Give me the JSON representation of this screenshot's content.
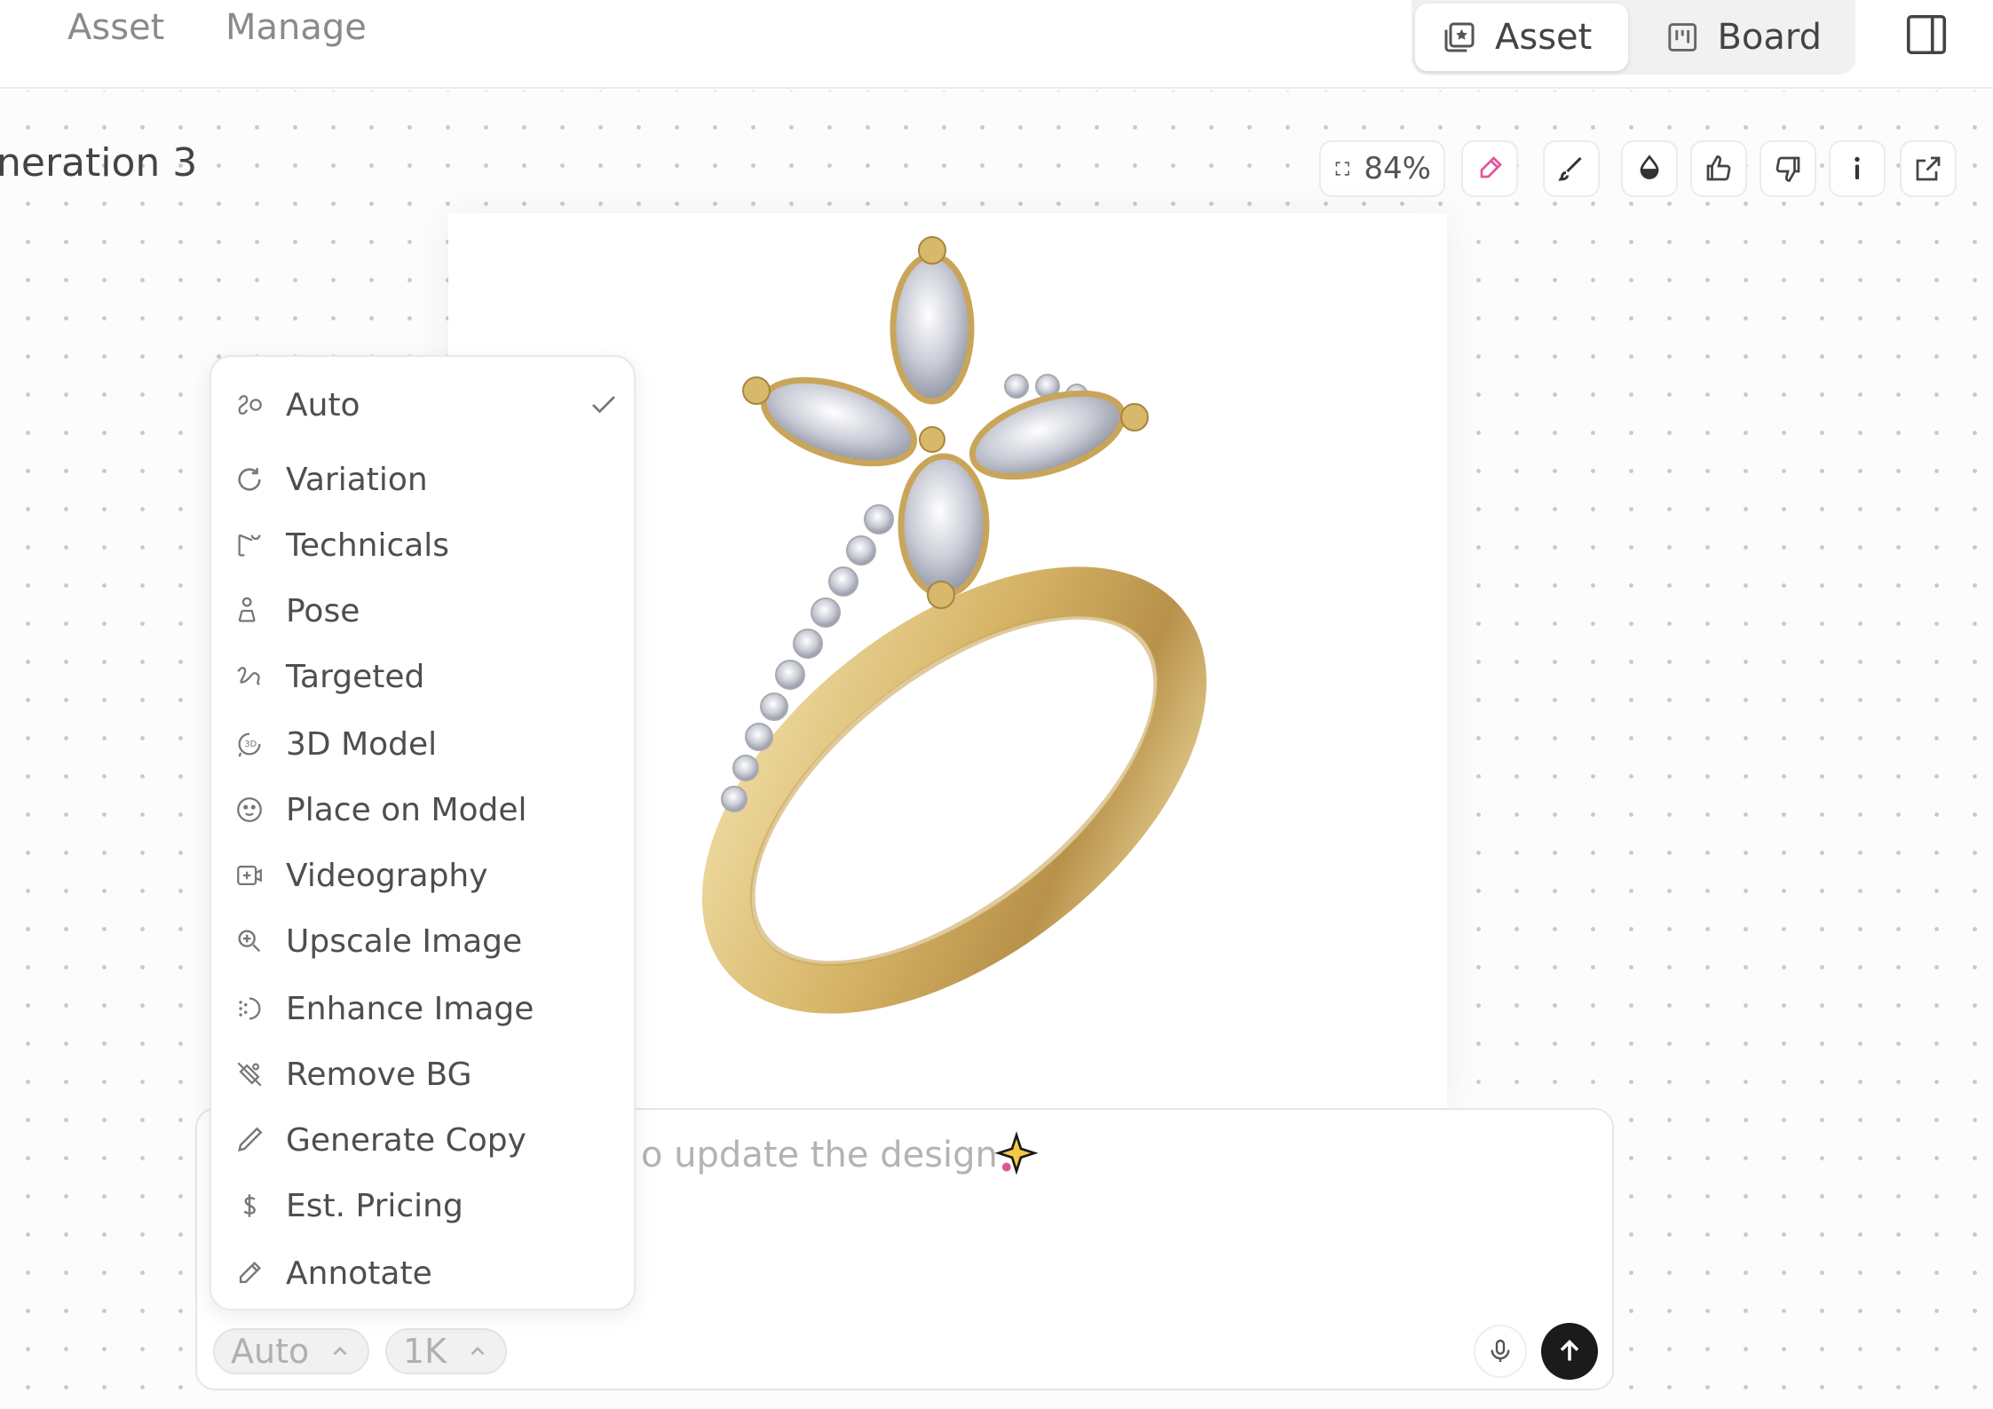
{
  "topbar": {
    "nav": [
      "Asset",
      "Manage"
    ],
    "view_toggle": [
      {
        "label": "Asset",
        "icon": "asset-icon",
        "active": true
      },
      {
        "label": "Board",
        "icon": "board-icon",
        "active": false
      }
    ],
    "panel_icon": "panel-toggle-icon"
  },
  "canvas": {
    "title": "neration 3",
    "zoom": "84%",
    "tools": [
      "fit-screen-icon",
      "color-picker-icon",
      "brush-icon",
      "tone-icon",
      "thumbs-up-icon",
      "thumbs-down-icon",
      "info-icon",
      "open-external-icon"
    ]
  },
  "menu": {
    "selected": "Auto",
    "items": [
      {
        "label": "Auto",
        "icon": "auto-icon"
      },
      {
        "label": "Variation",
        "icon": "refresh-icon"
      },
      {
        "label": "Technicals",
        "icon": "technicals-icon"
      },
      {
        "label": "Pose",
        "icon": "pose-icon"
      },
      {
        "label": "Targeted",
        "icon": "targeted-icon"
      },
      {
        "label": "3D Model",
        "icon": "rotate-3d-icon"
      },
      {
        "label": "Place on Model",
        "icon": "face-icon"
      },
      {
        "label": "Videography",
        "icon": "video-icon"
      },
      {
        "label": "Upscale Image",
        "icon": "zoom-in-icon"
      },
      {
        "label": "Enhance Image",
        "icon": "enhance-icon"
      },
      {
        "label": "Remove BG",
        "icon": "remove-bg-icon"
      },
      {
        "label": "Generate Copy",
        "icon": "pen-icon"
      },
      {
        "label": "Est. Pricing",
        "icon": "dollar-icon"
      },
      {
        "label": "Annotate",
        "icon": "pencil-icon"
      }
    ]
  },
  "prompt": {
    "placeholder": "o update the design",
    "mode": "Auto",
    "resolution": "1K"
  },
  "colors": {
    "accent_pink": "#e0559a",
    "gold": "#d9b86a",
    "send": "#1b1b1b"
  }
}
